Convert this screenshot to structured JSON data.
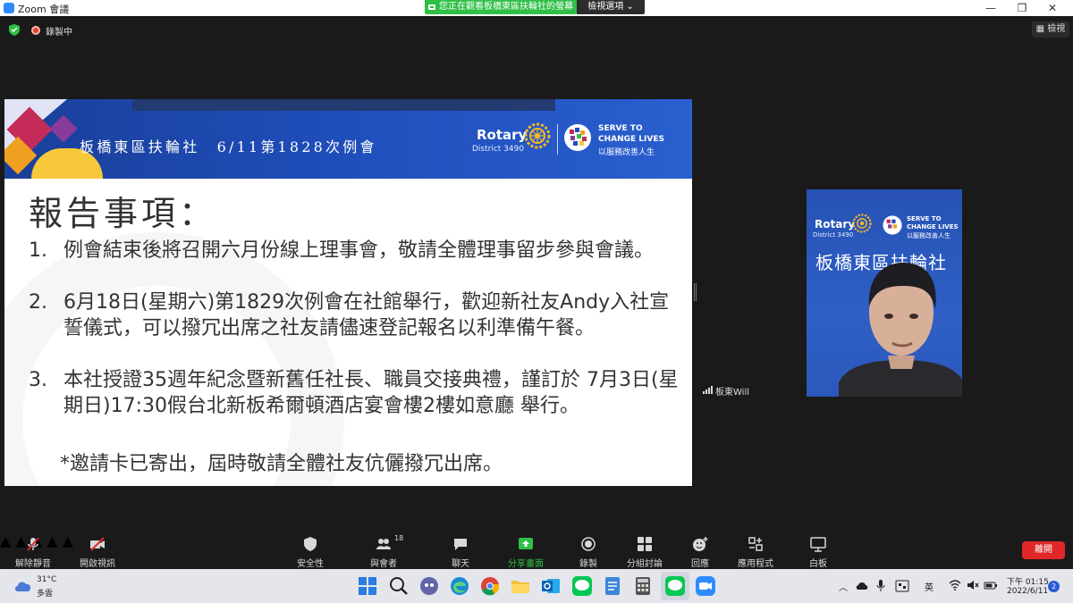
{
  "window": {
    "title": "Zoom 會議",
    "share_banner": "您正在觀看板橋東區扶輪社的螢幕",
    "view_options": "檢視選項 ⌄",
    "minimize": "—",
    "maximize": "❐",
    "close": "✕"
  },
  "meeting_bar": {
    "recording_label": "錄製中",
    "view_label": "檢視"
  },
  "slide": {
    "title": "板橋東區扶輪社　6/11第1828次例會",
    "rotary": "Rotary",
    "district": "District 3490",
    "serve_line1": "SERVE TO",
    "serve_line2": "CHANGE LIVES",
    "serve_line3": "以服務改善人生",
    "heading": "報告事項：",
    "items": [
      {
        "num": "1.",
        "text": "例會結束後將召開六月份線上理事會，敬請全體理事留步參與會議。"
      },
      {
        "num": "2.",
        "text": "6月18日(星期六)第1829次例會在社館舉行，歡迎新社友Andy入社宣誓儀式，可以撥冗出席之社友請儘速登記報名以利準備午餐。"
      },
      {
        "num": "3.",
        "text": "本社授證35週年紀念暨新舊任社長、職員交接典禮，謹訂於 7月3日(星期日)17:30假台北新板希爾頓酒店宴會樓2樓如意廳 舉行。"
      }
    ],
    "note": "*邀請卡已寄出，屆時敬請全體社友伉儷撥冗出席。"
  },
  "participant": {
    "name": "板東Will",
    "backdrop_rotary": "Rotary",
    "backdrop_district": "District 3490",
    "backdrop_serve1": "SERVE TO",
    "backdrop_serve2": "CHANGE LIVES",
    "backdrop_serve3": "以服務改善人生",
    "backdrop_club": "板橋東區扶輪社"
  },
  "toolbar": {
    "unmute": "解除靜音",
    "start_video": "開啟視訊",
    "security": "安全性",
    "participants": "與會者",
    "participant_count": "18",
    "chat": "聊天",
    "share": "分享畫面",
    "record": "錄製",
    "breakout": "分組討論",
    "reactions": "回應",
    "apps": "應用程式",
    "whiteboard": "白板",
    "leave": "離開"
  },
  "taskbar": {
    "temperature": "31°C",
    "weather": "多雲",
    "ime": "英",
    "time": "下午 01:15",
    "date": "2022/6/11",
    "notifications": "2"
  }
}
